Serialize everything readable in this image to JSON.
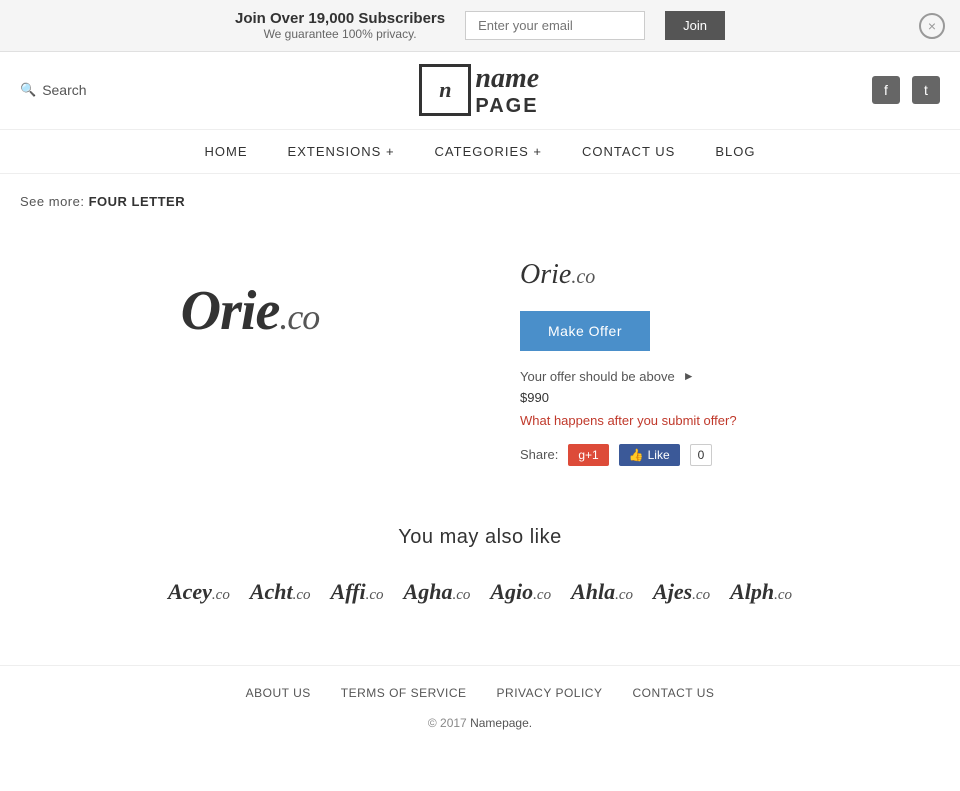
{
  "banner": {
    "main_text": "Join Over 19,000 Subscribers",
    "sub_text": "We guarantee 100% privacy.",
    "email_placeholder": "Enter your email",
    "join_label": "Join",
    "close_label": "×"
  },
  "header": {
    "search_label": "Search",
    "logo_icon": "n",
    "logo_name": "name",
    "logo_page": "PAGE",
    "facebook_icon": "f",
    "twitter_icon": "t"
  },
  "nav": {
    "items": [
      {
        "label": "HOME",
        "href": "#"
      },
      {
        "label": "EXTENSIONS +",
        "href": "#"
      },
      {
        "label": "CATEGORIES +",
        "href": "#"
      },
      {
        "label": "CONTACT  US",
        "href": "#"
      },
      {
        "label": "BLOG",
        "href": "#"
      }
    ]
  },
  "breadcrumb": {
    "prefix": "See more:",
    "link_text": "FOUR LETTER"
  },
  "domain": {
    "name": "Orie",
    "tld": ".co",
    "full": "Orie.co",
    "make_offer_label": "Make Offer",
    "offer_note": "Your offer should be above",
    "offer_amount": "$990",
    "what_happens": "What happens after you submit offer?",
    "share_label": "Share:",
    "gplus_label": "g+1",
    "fb_label": "Like",
    "fb_count": "0"
  },
  "also_like": {
    "title": "You may also like",
    "items": [
      {
        "name": "Acey",
        "tld": ".co"
      },
      {
        "name": "Acht",
        "tld": ".co"
      },
      {
        "name": "Affi",
        "tld": ".co"
      },
      {
        "name": "Agha",
        "tld": ".co"
      },
      {
        "name": "Agio",
        "tld": ".co"
      },
      {
        "name": "Ahla",
        "tld": ".co"
      },
      {
        "name": "Ajes",
        "tld": ".co"
      },
      {
        "name": "Alph",
        "tld": ".co"
      }
    ]
  },
  "footer": {
    "links": [
      {
        "label": "ABOUT  US"
      },
      {
        "label": "TERMS  OF  SERVICE"
      },
      {
        "label": "PRIVACY  POLICY"
      },
      {
        "label": "CONTACT  US"
      }
    ],
    "copyright": "© 2017",
    "copyright_link": "Namepage."
  }
}
